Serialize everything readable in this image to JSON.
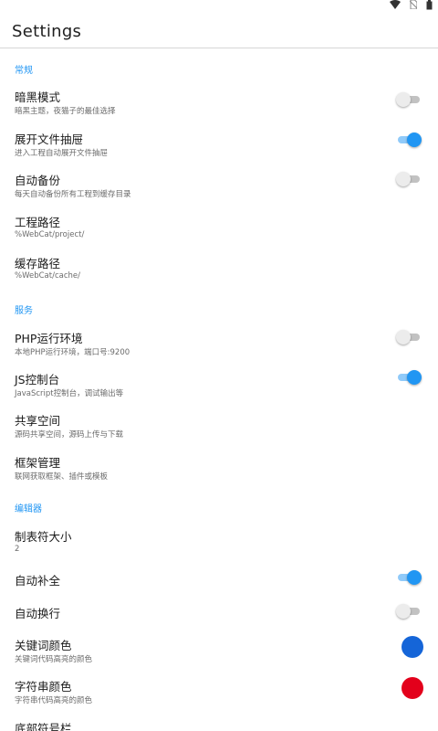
{
  "header": {
    "title": "Settings"
  },
  "colors": {
    "accent": "#2196f3",
    "keyword_color": "#1565d8",
    "string_color": "#e3001b"
  },
  "sections": {
    "general": {
      "label": "常规",
      "dark_mode": {
        "title": "暗黑模式",
        "subtitle": "暗黑主题，夜猫子的最佳选择",
        "enabled": false
      },
      "expand_drawer": {
        "title": "展开文件抽屉",
        "subtitle": "进入工程自动展开文件抽屉",
        "enabled": true
      },
      "auto_backup": {
        "title": "自动备份",
        "subtitle": "每天自动备份所有工程到缓存目录",
        "enabled": false
      },
      "project_path": {
        "title": "工程路径",
        "subtitle": "%WebCat/project/"
      },
      "cache_path": {
        "title": "缓存路径",
        "subtitle": "%WebCat/cache/"
      }
    },
    "service": {
      "label": "服务",
      "php_env": {
        "title": "PHP运行环境",
        "subtitle": "本地PHP运行环境，端口号:9200",
        "enabled": false
      },
      "js_console": {
        "title": "JS控制台",
        "subtitle": "JavaScript控制台，调试输出等",
        "enabled": true
      },
      "shared_space": {
        "title": "共享空间",
        "subtitle": "源码共享空间，源码上传与下载"
      },
      "framework": {
        "title": "框架管理",
        "subtitle": "联网获取框架、插件或模板"
      }
    },
    "editor": {
      "label": "编辑器",
      "tab_size": {
        "title": "制表符大小",
        "value": "2"
      },
      "auto_complete": {
        "title": "自动补全",
        "enabled": true
      },
      "auto_wrap": {
        "title": "自动换行",
        "enabled": false
      },
      "keyword_color": {
        "title": "关键词颜色",
        "subtitle": "关键词代码高亮的颜色"
      },
      "string_color": {
        "title": "字符串颜色",
        "subtitle": "字符串代码高亮的颜色"
      },
      "symbol_bar": {
        "title": "底部符号栏"
      }
    }
  }
}
